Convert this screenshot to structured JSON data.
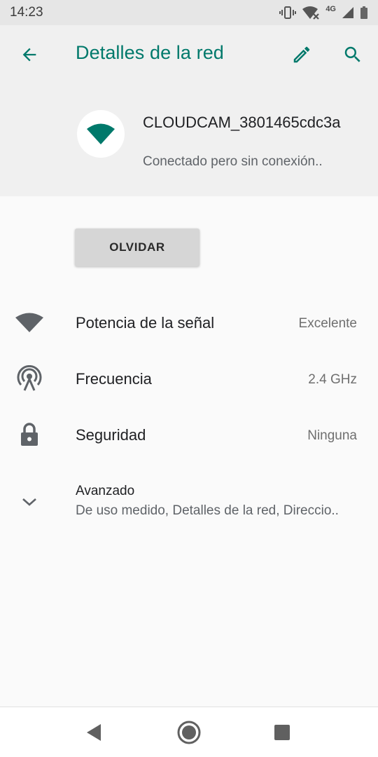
{
  "status_bar": {
    "time": "14:23",
    "network_type": "4G",
    "icons": [
      "vibrate-icon",
      "wifi-no-internet-icon",
      "cell-signal-icon",
      "battery-icon"
    ]
  },
  "toolbar": {
    "title": "Detalles de la red",
    "icons": [
      "back-arrow-icon",
      "pencil-icon",
      "search-icon"
    ],
    "accent_color": "#00796b"
  },
  "network": {
    "name": "CLOUDCAM_3801465cdc3a",
    "status": "Conectado pero sin conexión..",
    "icon": "wifi-icon"
  },
  "forget_button": {
    "label": "OLVIDAR"
  },
  "details": [
    {
      "label": "Potencia de la señal",
      "value": "Excelente",
      "icon": "wifi-signal-icon"
    },
    {
      "label": "Frecuencia",
      "value": "2.4 GHz",
      "icon": "antenna-icon"
    },
    {
      "label": "Seguridad",
      "value": "Ninguna",
      "icon": "lock-icon"
    }
  ],
  "advanced": {
    "title": "Avanzado",
    "summary": "De uso medido, Detalles de la red, Direccio..",
    "icon": "chevron-down-icon"
  },
  "nav_bar": {
    "icons": [
      "back-triangle-icon",
      "home-circle-icon",
      "recents-square-icon"
    ]
  }
}
